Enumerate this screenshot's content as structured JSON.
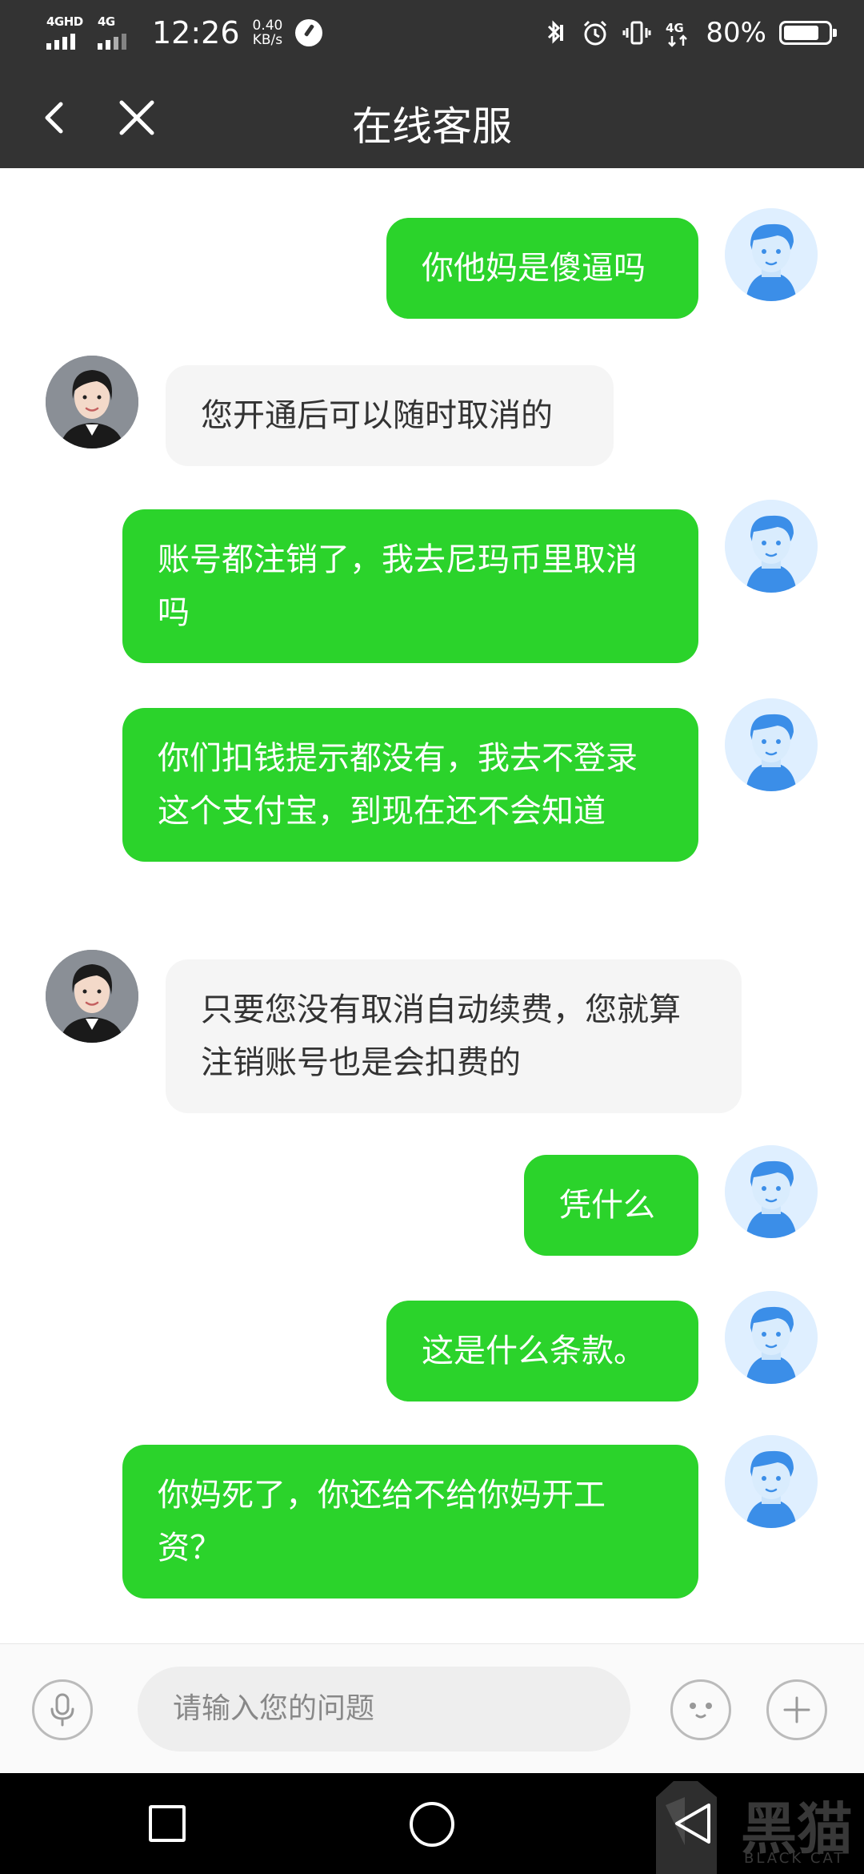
{
  "status_bar": {
    "signal1_label": "4GHD",
    "signal2_label": "4G",
    "time": "12:26",
    "speed_value": "0.40",
    "speed_unit": "KB/s",
    "network_label": "4G",
    "battery_percent": "80%",
    "battery_level": 0.8
  },
  "header": {
    "title": "在线客服",
    "back_icon": "chevron-left-icon",
    "close_icon": "close-icon"
  },
  "messages": [
    {
      "sender": "user",
      "text": "你他妈是傻逼吗"
    },
    {
      "sender": "agent",
      "text": "您开通后可以随时取消的"
    },
    {
      "sender": "user",
      "text": "账号都注销了，我去尼玛币里取消吗"
    },
    {
      "sender": "user",
      "text": "你们扣钱提示都没有，我去不登录这个支付宝，到现在还不会知道"
    },
    {
      "sender": "agent",
      "text": "只要您没有取消自动续费，您就算注销账号也是会扣费的"
    },
    {
      "sender": "user",
      "text": "凭什么"
    },
    {
      "sender": "user",
      "text": "这是什么条款。"
    },
    {
      "sender": "user",
      "text": "你妈死了，你还给不给你妈开工资？"
    }
  ],
  "input_bar": {
    "placeholder": "请输入您的问题",
    "mic_icon": "microphone-icon",
    "emoji_icon": "emoji-face-icon",
    "plus_icon": "plus-icon"
  },
  "nav_bar": {
    "recent_icon": "square-icon",
    "home_icon": "circle-icon",
    "back_icon": "triangle-back-icon"
  },
  "watermark": {
    "text": "黑猫",
    "subtext": "BLACK CAT"
  },
  "colors": {
    "header_bg": "#333333",
    "user_bubble": "#2bd32b",
    "agent_bubble": "#f5f5f5"
  }
}
